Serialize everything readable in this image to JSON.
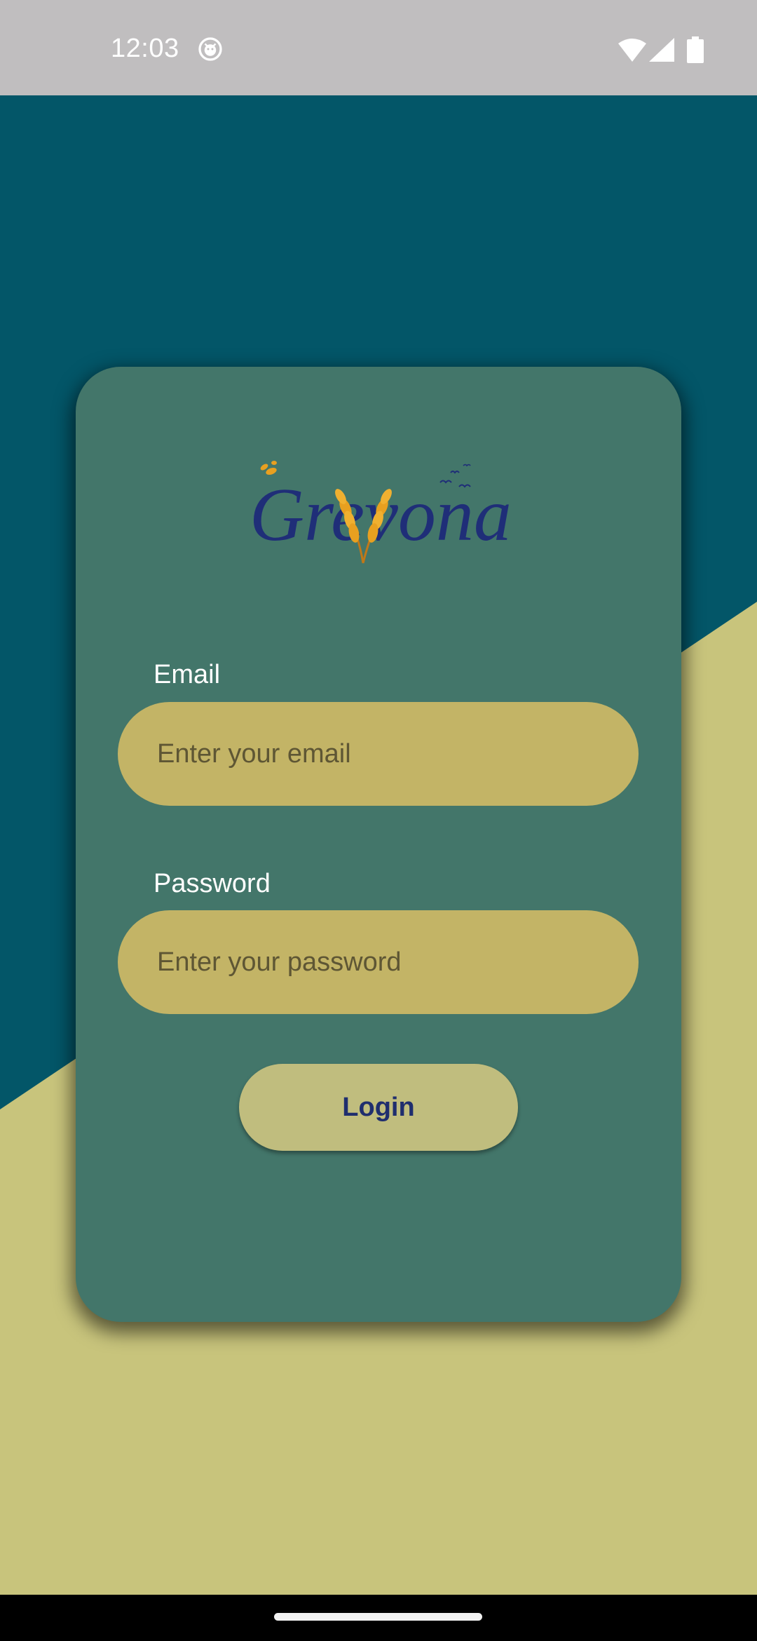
{
  "status_bar": {
    "time": "12:03"
  },
  "brand": {
    "logo_text": "Grevona"
  },
  "form": {
    "email_label": "Email",
    "email_placeholder": "Enter your email",
    "email_value": "",
    "password_label": "Password",
    "password_placeholder": "Enter your password",
    "password_value": "",
    "login_label": "Login"
  },
  "colors": {
    "top_background": "#035668",
    "bottom_background": "#c8c47c",
    "card": "#43766a",
    "input_fill": "#c3b466",
    "button_fill": "#c0bd7e",
    "button_text": "#1f2e6e",
    "logo_text": "#1f2e78",
    "logo_wheat": "#e8a020"
  },
  "icons": {
    "status_notification": "android-debug-icon",
    "status_wifi": "wifi-icon",
    "status_signal": "cell-signal-icon",
    "status_battery": "battery-icon",
    "logo_mark": "wheat-icon"
  }
}
